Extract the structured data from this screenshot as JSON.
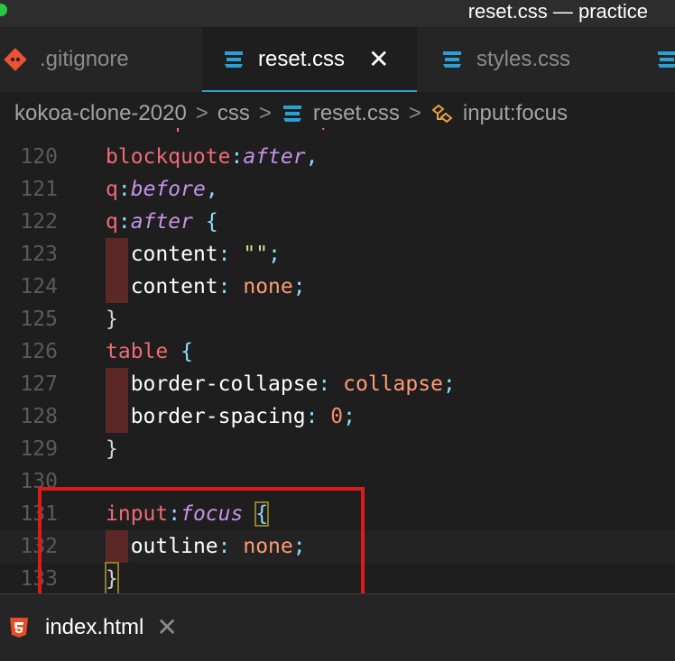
{
  "window": {
    "title": "reset.css — practice"
  },
  "tabs": [
    {
      "label": ".gitignore",
      "icon": "git-icon",
      "color": "#f05133"
    },
    {
      "label": "reset.css",
      "icon": "css-icon",
      "color": "#2aa1d6",
      "active": true,
      "close": "✕"
    },
    {
      "label": "styles.css",
      "icon": "css-icon",
      "color": "#2aa1d6"
    }
  ],
  "breadcrumb": {
    "items": [
      "kokoa-clone-2020",
      "css",
      "reset.css",
      "input:focus"
    ],
    "separator": ">"
  },
  "editor": {
    "partial_top": "blockquote:before,",
    "lines": [
      {
        "num": "120",
        "text": "blockquote:after,"
      },
      {
        "num": "121",
        "text": "q:before,"
      },
      {
        "num": "122",
        "text": "q:after {"
      },
      {
        "num": "123",
        "text": "content: \"\";"
      },
      {
        "num": "124",
        "text": "content: none;"
      },
      {
        "num": "125",
        "text": "}"
      },
      {
        "num": "126",
        "text": "table {"
      },
      {
        "num": "127",
        "text": "border-collapse: collapse;"
      },
      {
        "num": "128",
        "text": "border-spacing: 0;"
      },
      {
        "num": "129",
        "text": "}"
      },
      {
        "num": "130",
        "text": ""
      },
      {
        "num": "131",
        "text": "input:focus {"
      },
      {
        "num": "132",
        "text": "outline: none;"
      },
      {
        "num": "133",
        "text": "}"
      }
    ],
    "colors": {
      "selector": "#ef6b73",
      "pseudo": "#c792ea",
      "value": "#ff9b76"
    }
  },
  "bottom_tab": {
    "label": "index.html",
    "icon": "html5-icon",
    "close": "✕"
  }
}
